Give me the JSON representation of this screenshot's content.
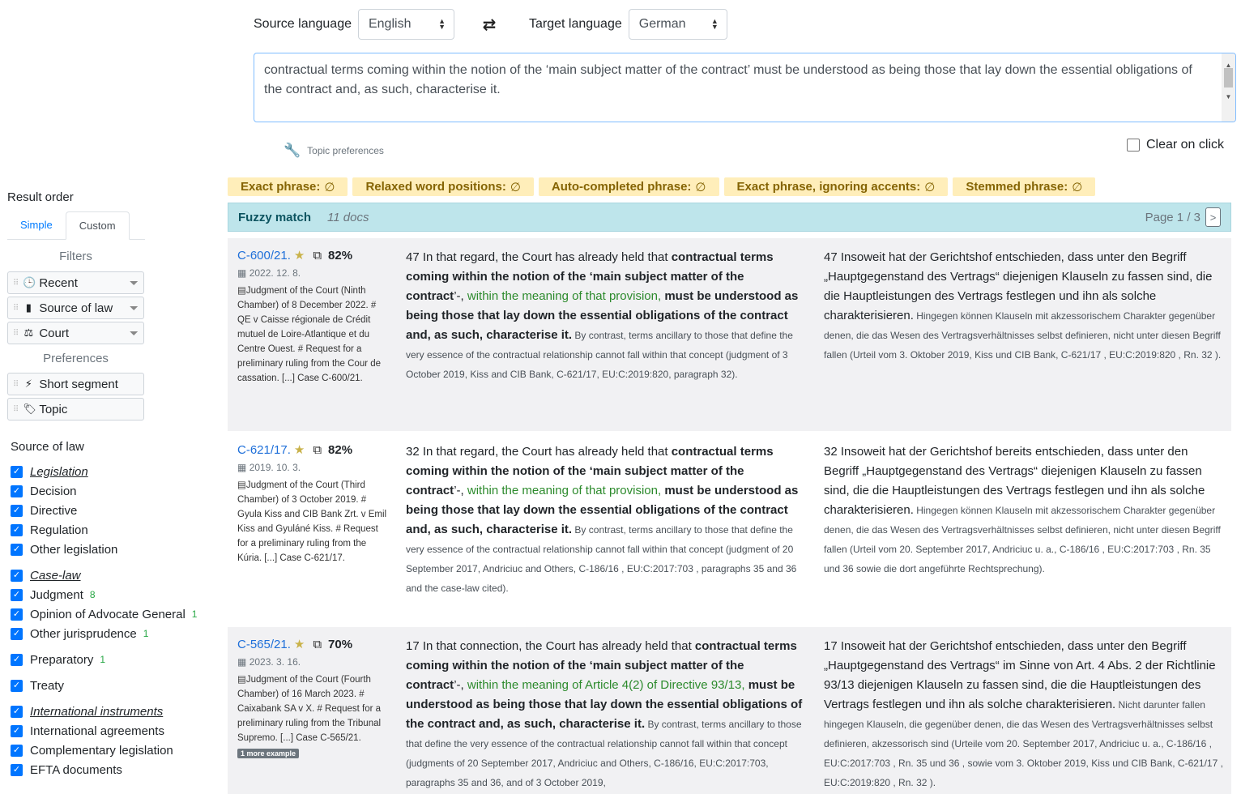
{
  "translate": {
    "source_label": "Source language",
    "source_value": "English",
    "target_label": "Target language",
    "target_value": "German",
    "query": "contractual terms coming within the notion of the ‘main subject matter of the contract’ must be understood as being those that lay down the essential obligations of the contract and, as such, characterise it.",
    "topic_preferences": "Topic preferences",
    "clear_on_click": "Clear on click"
  },
  "sidebar": {
    "result_order": "Result order",
    "tabs": {
      "simple": "Simple",
      "custom": "Custom"
    },
    "filters_title": "Filters",
    "filters": [
      "Recent",
      "Source of law",
      "Court"
    ],
    "preferences_title": "Preferences",
    "preferences": [
      "Short segment",
      "Topic"
    ],
    "source_of_law_title": "Source of law",
    "sol": [
      {
        "label": "Legislation"
      },
      {
        "label": "Decision"
      },
      {
        "label": "Directive"
      },
      {
        "label": "Regulation"
      },
      {
        "label": "Other legislation"
      },
      {
        "label": "Case-law"
      },
      {
        "label": "Judgment",
        "count": "8"
      },
      {
        "label": "Opinion of Advocate General",
        "count": "1"
      },
      {
        "label": "Other jurisprudence",
        "count": "1"
      },
      {
        "label": "Preparatory",
        "count": "1"
      },
      {
        "label": "Treaty"
      },
      {
        "label": "International instruments"
      },
      {
        "label": "International agreements"
      },
      {
        "label": "Complementary legislation"
      },
      {
        "label": "EFTA documents"
      }
    ]
  },
  "badges": [
    {
      "label": "Exact phrase:",
      "value": "∅"
    },
    {
      "label": "Relaxed word positions:",
      "value": "∅"
    },
    {
      "label": "Auto-completed phrase:",
      "value": "∅"
    },
    {
      "label": "Exact phrase, ignoring accents:",
      "value": "∅"
    },
    {
      "label": "Stemmed phrase:",
      "value": "∅"
    }
  ],
  "fuzzy": {
    "title": "Fuzzy match",
    "docs": "11 docs",
    "page": "Page 1 / 3",
    "next": ">"
  },
  "results": [
    {
      "case": "C-600/21.",
      "pct": "82%",
      "date": "2022. 12. 8.",
      "meta": "Judgment of the Court (Ninth Chamber) of 8 December 2022. # QE v Caisse régionale de Crédit mutuel de Loire-Atlantique et du Centre Ouest. # Request for a preliminary ruling from the Cour de cassation. [...] Case C-600/21.",
      "src_pre": "47 In that regard, the Court has already held that ",
      "src_b1": "contractual terms coming within the notion of the ‘main subject matter of the contract",
      "src_mid": "’-,",
      "src_green": " within the meaning of that provision, ",
      "src_b2": "must be understood as being those that lay down the essential obligations of the contract and, as such, characterise it.",
      "src_small": " By contrast, terms ancillary to those that define the very essence of the contractual relationship cannot fall within that concept (judgment of 3 October 2019, Kiss and CIB Bank, C-621/17, EU:C:2019:820, paragraph 32).",
      "tgt_main": "47 Insoweit hat der Gerichtshof entschieden, dass unter den Begriff „Hauptgegenstand des Vertrags“ diejenigen Klauseln zu fassen sind, die die Hauptleistungen des Vertrags festlegen und ihn als solche charakterisieren.",
      "tgt_small": " Hingegen können Klauseln mit akzessorischem Charakter gegenüber denen, die das Wesen des Vertragsverhältnisses selbst definieren, nicht unter diesen Begriff fallen (Urteil vom 3. Oktober 2019, Kiss und CIB Bank, C-621/17 , EU:C:2019:820 , Rn. 32 )."
    },
    {
      "case": "C-621/17.",
      "pct": "82%",
      "date": "2019. 10. 3.",
      "meta": "Judgment of the Court (Third Chamber) of 3 October 2019. # Gyula Kiss and CIB Bank Zrt. v Emil Kiss and Gyuláné Kiss. # Request for a preliminary ruling from the Kúria. [...] Case C-621/17.",
      "src_pre": "32 In that regard, the Court has already held that ",
      "src_b1": "contractual terms coming within the notion of the ‘main subject matter of the contract",
      "src_mid": "’-,",
      "src_green": " within the meaning of that provision, ",
      "src_b2": "must be understood as being those that lay down the essential obligations of the contract and, as such, characterise it.",
      "src_small": " By contrast, terms ancillary to those that define the very essence of the contractual relationship cannot fall within that concept (judgment of 20 September 2017, Andriciuc and Others, C-186/16 , EU:C:2017:703 , paragraphs 35 and 36 and the case-law cited).",
      "tgt_main": "32 Insoweit hat der Gerichtshof bereits entschieden, dass unter den Begriff „Hauptgegenstand des Vertrags“ diejenigen Klauseln zu fassen sind, die die Hauptleistungen des Vertrags festlegen und ihn als solche charakterisieren.",
      "tgt_small": " Hingegen können Klauseln mit akzessorischem Charakter gegenüber denen, die das Wesen des Vertragsverhältnisses selbst definieren, nicht unter diesen Begriff fallen (Urteil vom 20. September 2017, Andriciuc u. a., C-186/16 , EU:C:2017:703 , Rn. 35 und 36 sowie die dort angeführte Rechtsprechung)."
    },
    {
      "case": "C-565/21.",
      "pct": "70%",
      "date": "2023. 3. 16.",
      "meta": "Judgment of the Court (Fourth Chamber) of 16 March 2023. # Caixabank SA v X. # Request for a preliminary ruling from the Tribunal Supremo. [...] Case C-565/21.",
      "more": "1 more example",
      "src_pre": "17 In that connection, the Court has already held that ",
      "src_b1": "contractual terms coming within the notion of the ‘main subject matter of the contract",
      "src_mid": "’-,",
      "src_green": " within the meaning of Article 4(2) of Directive 93/13, ",
      "src_b2": "must be understood as being those that lay down the essential obligations of the contract and, as such, characterise it.",
      "src_small": " By contrast, terms ancillary to those that define the very essence of the contractual relationship cannot fall within that concept (judgments of 20 September 2017, Andriciuc and Others, C-186/16, EU:C:2017:703, paragraphs 35 and 36, and of 3 October 2019,",
      "tgt_main": "17 Insoweit hat der Gerichtshof entschieden, dass unter den Begriff „Hauptgegenstand des Vertrags“ im Sinne von Art. 4 Abs. 2 der Richtlinie 93/13 diejenigen Klauseln zu fassen sind, die die Hauptleistungen des Vertrags festlegen und ihn als solche charakterisieren.",
      "tgt_small": " Nicht darunter fallen hingegen Klauseln, die gegenüber denen, die das Wesen des Vertragsverhältnisses selbst definieren, akzessorisch sind (Urteile vom 20. September 2017, Andriciuc u. a., C-186/16 , EU:C:2017:703 , Rn. 35 und 36 , sowie vom 3. Oktober 2019, Kiss und CIB Bank, C-621/17 , EU:C:2019:820 , Rn. 32 )."
    }
  ]
}
